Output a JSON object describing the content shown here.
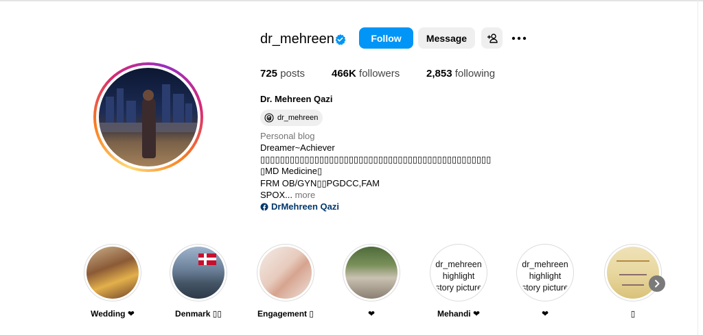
{
  "profile": {
    "username": "dr_mehreen",
    "follow_label": "Follow",
    "message_label": "Message",
    "posts_count": "725",
    "posts_label": "posts",
    "followers_count": "466K",
    "followers_label": "followers",
    "following_count": "2,853",
    "following_label": "following",
    "full_name": "Dr. Mehreen Qazi",
    "threads_handle": "dr_mehreen",
    "category": "Personal blog",
    "bio_lines": [
      "Dreamer~Achiever",
      "▯▯▯▯▯▯▯▯▯▯▯▯▯▯▯▯▯▯▯▯▯▯▯▯▯▯▯▯▯▯▯▯▯▯▯▯▯▯▯▯▯▯▯▯▯▯▯",
      "▯MD Medicine▯",
      "FRM OB/GYN▯▯PGDCC,FAM",
      "SPOX..."
    ],
    "more_label": "more",
    "facebook_link": "DrMehreen Qazi"
  },
  "highlights": [
    {
      "label": "Wedding ❤",
      "placeholder": ""
    },
    {
      "label": "Denmark ▯▯",
      "placeholder": ""
    },
    {
      "label": "Engagement ▯",
      "placeholder": ""
    },
    {
      "label": "❤",
      "placeholder": ""
    },
    {
      "label": "Mehandi ❤",
      "placeholder": "dr_mehreen\nhighlight\nstory picture"
    },
    {
      "label": "❤",
      "placeholder": "dr_mehreen\nhighlight\nstory picture"
    },
    {
      "label": "▯",
      "placeholder": ""
    }
  ],
  "colors": {
    "follow_button": "#0095f6",
    "secondary_button": "#efefef",
    "link": "#00376b",
    "verified_badge": "#0095f6"
  },
  "icons": [
    "verified-icon",
    "add-person-icon",
    "more-icon",
    "threads-icon",
    "facebook-icon",
    "chevron-right-icon"
  ]
}
